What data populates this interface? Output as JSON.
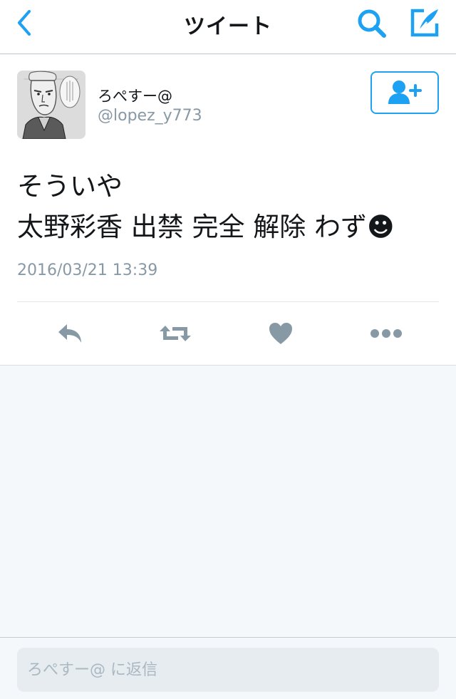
{
  "nav": {
    "title": "ツイート",
    "back_icon": "chevron-left-icon",
    "search_icon": "search-icon",
    "compose_icon": "compose-icon"
  },
  "tweet": {
    "display_name": "ろぺすー@",
    "handle": "@lopez_y773",
    "text": "そういや\n太野彩香 出禁 完全 解除 わず☻",
    "timestamp": "2016/03/21 13:39",
    "follow_icon": "add-user-icon",
    "actions": [
      "reply-icon",
      "retweet-icon",
      "like-icon",
      "more-icon"
    ]
  },
  "reply": {
    "placeholder": "ろぺすー@ に返信"
  },
  "colors": {
    "accent": "#1da1f2",
    "icon_gray": "#8899a6",
    "background": "#f5f8fa"
  }
}
